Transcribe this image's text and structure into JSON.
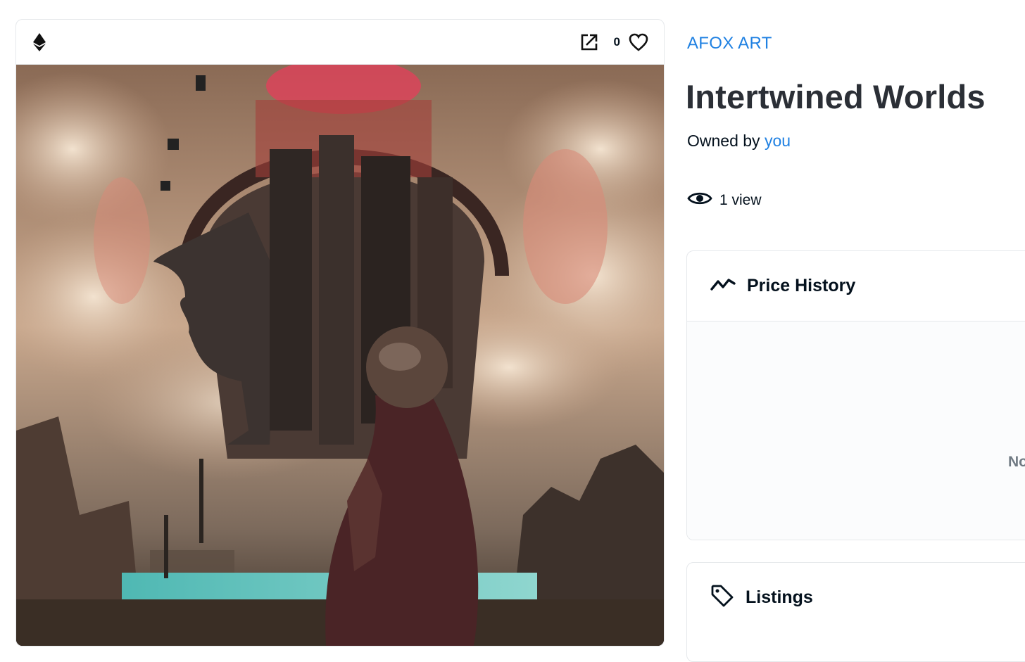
{
  "media": {
    "chain_icon": "ethereum-icon",
    "external_link_icon": "external-link-icon",
    "favorite_icon": "heart-icon",
    "favorite_count": "0",
    "artwork_description_icon": "artwork-image"
  },
  "item": {
    "collection": "AFOX ART",
    "title": "Intertwined Worlds",
    "owned_by_label": "Owned by",
    "owner": "you",
    "views": "1 view",
    "views_icon": "eye-icon"
  },
  "panels": {
    "price_history": {
      "icon": "activity-line-icon",
      "title": "Price History",
      "empty_text": "No"
    },
    "listings": {
      "icon": "tag-icon",
      "title": "Listings"
    }
  },
  "colors": {
    "link": "#2081e2",
    "border": "#e5e8eb",
    "title": "#2b2f36",
    "muted": "#707a83"
  }
}
